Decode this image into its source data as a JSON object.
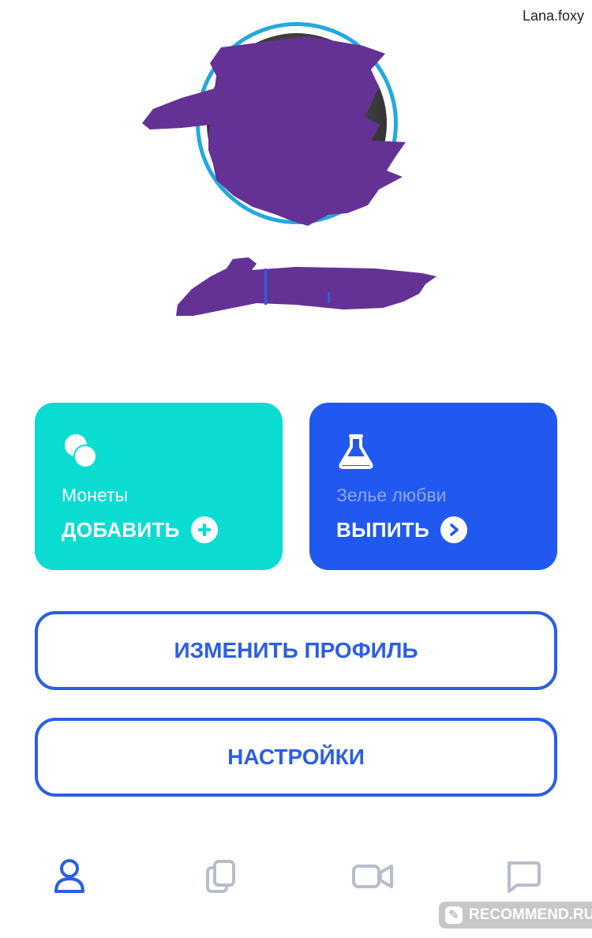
{
  "watermark_top": "Lana.foxy",
  "cards": {
    "coins": {
      "label": "Монеты",
      "action": "ДОБАВИТЬ",
      "icon": "coins-icon"
    },
    "potion": {
      "label": "Зелье любви",
      "action": "ВЫПИТЬ",
      "icon": "flask-icon"
    }
  },
  "buttons": {
    "edit_profile": "ИЗМЕНИТЬ ПРОФИЛЬ",
    "settings": "НАСТРОЙКИ"
  },
  "nav": [
    {
      "icon": "profile-icon",
      "active": true
    },
    {
      "icon": "cards-icon",
      "active": false
    },
    {
      "icon": "video-icon",
      "active": false
    },
    {
      "icon": "chat-icon",
      "active": false
    }
  ],
  "watermark_bottom": "RECOMMEND.RU",
  "colors": {
    "coins_card": "#0bdcd1",
    "potion_card": "#2158f0",
    "accent": "#2b5fe2",
    "avatar_ring": "#23a8e0",
    "redaction": "#643295",
    "nav_inactive": "#b9bccb"
  }
}
